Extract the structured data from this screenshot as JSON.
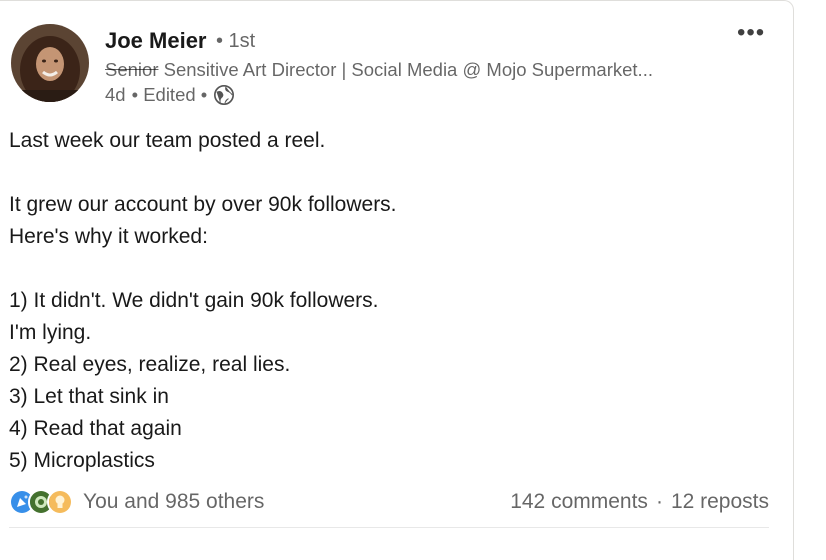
{
  "post": {
    "author_name": "Joe Meier",
    "degree": "• 1st",
    "headline_strike": "Senior",
    "headline_rest": " Sensitive Art Director | Social Media @ Mojo Supermarket...",
    "time": "4d",
    "edited": "• Edited •",
    "more_label": "•••",
    "visibility_icon": "globe-icon",
    "body": [
      "Last week our team posted a reel.",
      "",
      "It grew our account by over 90k followers.",
      "Here's why it worked:",
      "",
      "1) It didn't. We didn't gain 90k followers.",
      "I'm lying.",
      "2) Real eyes, realize, real lies.",
      "3) Let that sink in",
      "4) Read that again",
      "5) Microplastics"
    ]
  },
  "social": {
    "reaction_icons": [
      "celebrate-icon",
      "support-icon",
      "insightful-icon"
    ],
    "reactions_label": "You and 985 others",
    "comments": "142 comments",
    "separator": "·",
    "reposts": "12 reposts"
  },
  "colors": {
    "text_primary": "#000000e6",
    "text_secondary": "#00000099",
    "celebrate": "#44712e",
    "support": "#378fe9",
    "insightful": "#f5bb5c"
  }
}
